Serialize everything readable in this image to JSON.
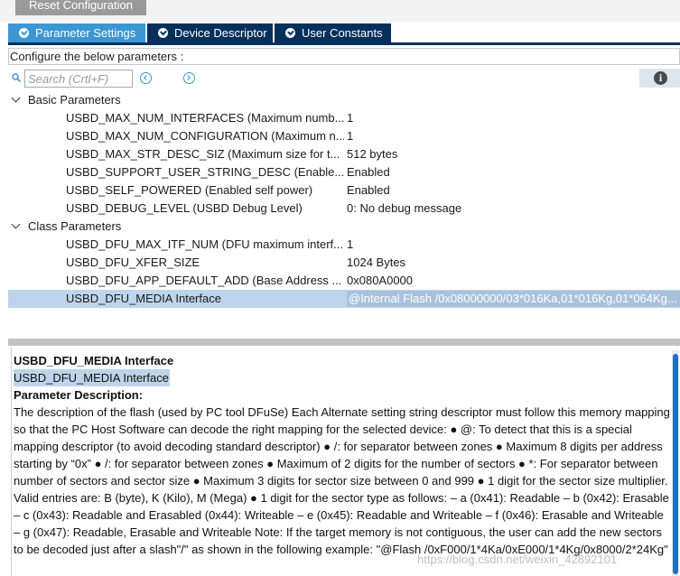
{
  "toolbar": {
    "reset_label": "Reset Configuration"
  },
  "tabs": [
    {
      "label": "Parameter Settings",
      "active": true
    },
    {
      "label": "Device Descriptor",
      "active": false
    },
    {
      "label": "User Constants",
      "active": false
    }
  ],
  "configure_text": "Configure the below parameters :",
  "search": {
    "placeholder": "Search (Crtl+F)"
  },
  "icons": {
    "tab_check": "check-circle-icon",
    "search": "search-icon",
    "prev": "chevron-left-circle-icon",
    "next": "chevron-right-circle-icon",
    "info": "info-icon",
    "expand": "chevron-down-icon"
  },
  "colors": {
    "tab_active": "#3c96d2",
    "tab_inactive": "#06305c",
    "selection": "#bdd4ea",
    "scroll_thumb": "#1e6fc6"
  },
  "groups": [
    {
      "label": "Basic Parameters",
      "params": [
        {
          "name": "USBD_MAX_NUM_INTERFACES (Maximum numb...",
          "value": "1"
        },
        {
          "name": "USBD_MAX_NUM_CONFIGURATION (Maximum n...",
          "value": "1"
        },
        {
          "name": "USBD_MAX_STR_DESC_SIZ (Maximum size for t...",
          "value": "512 bytes"
        },
        {
          "name": "USBD_SUPPORT_USER_STRING_DESC (Enable...",
          "value": "Enabled"
        },
        {
          "name": "USBD_SELF_POWERED (Enabled self power)",
          "value": "Enabled"
        },
        {
          "name": "USBD_DEBUG_LEVEL (USBD Debug Level)",
          "value": "0: No debug message"
        }
      ]
    },
    {
      "label": "Class Parameters",
      "params": [
        {
          "name": "USBD_DFU_MAX_ITF_NUM (DFU maximum interf...",
          "value": "1"
        },
        {
          "name": "USBD_DFU_XFER_SIZE",
          "value": "1024 Bytes"
        },
        {
          "name": "USBD_DFU_APP_DEFAULT_ADD (Base Address ...",
          "value": "0x080A0000"
        },
        {
          "name": "USBD_DFU_MEDIA Interface",
          "value": "@Internal Flash   /0x08000000/03*016Ka,01*016Kg,01*064Kg...",
          "selected": true
        }
      ]
    }
  ],
  "description": {
    "title": "USBD_DFU_MEDIA Interface",
    "subtitle": "USBD_DFU_MEDIA Interface",
    "heading": "Parameter Description:",
    "body": "The description of the flash (used by PC tool DFuSe) Each Alternate setting string descriptor must follow this memory mapping so that the PC Host Software can decode the right mapping for the selected device: ● @: To detect that this is a special mapping descriptor (to avoid decoding standard descriptor) ● /: for separator between zones ● Maximum 8 digits per address starting by “0x” ● /: for separator between zones ● Maximum of 2 digits for the number of sectors ● *: For separator between number of sectors and sector size ● Maximum 3 digits for sector size between 0 and 999 ● 1 digit for the sector size multiplier. Valid entries are: B (byte), K (Kilo), M (Mega) ● 1 digit for the sector type as follows: – a (0x41): Readable – b (0x42): Erasable – c (0x43): Readable and Erasabled (0x44): Writeable – e (0x45): Readable and Writeable – f (0x46): Erasable and Writeable – g (0x47): Readable, Erasable and Writeable Note: If the target memory is not contiguous, the user can add the new sectors to be decoded just after a slash\"/\" as shown in the following example: \"@Flash /0xF000/1*4Ka/0xE000/1*4Kg/0x8000/2*24Kg\""
  },
  "watermark": "https://blog.csdn.net/weixin_42892101"
}
